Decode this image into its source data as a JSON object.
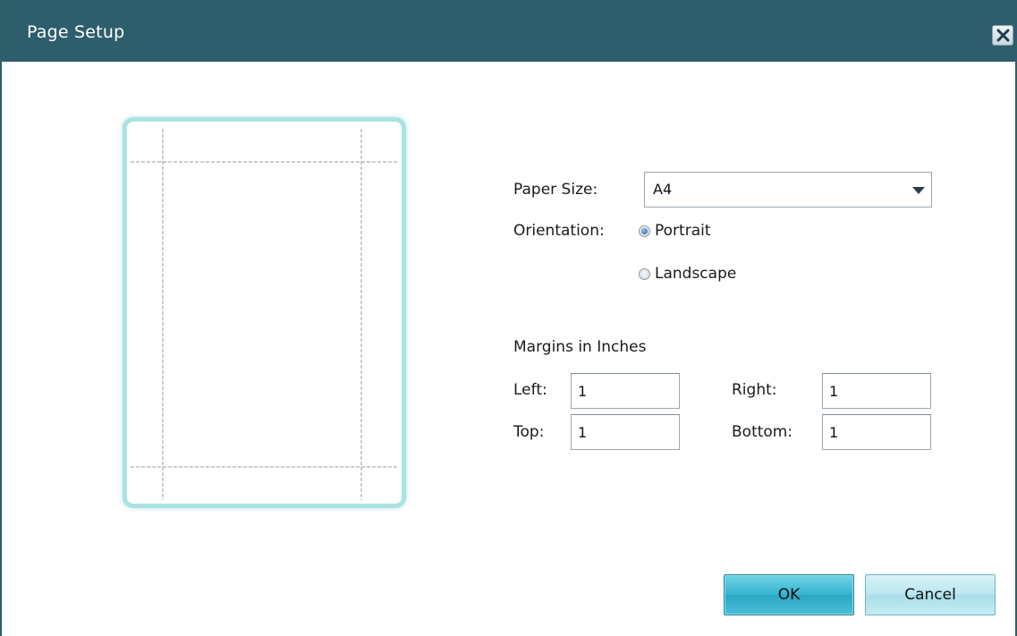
{
  "window": {
    "title": "Page Setup",
    "close_icon": "close-icon"
  },
  "paper": {
    "label": "Paper Size:",
    "value": "A4"
  },
  "orientation": {
    "label": "Orientation:",
    "options": [
      {
        "label": "Portrait",
        "checked": true
      },
      {
        "label": "Landscape",
        "checked": false
      }
    ]
  },
  "margins": {
    "heading": "Margins in Inches",
    "left_label": "Left:",
    "left_value": "1",
    "right_label": "Right:",
    "right_value": "1",
    "top_label": "Top:",
    "top_value": "1",
    "bottom_label": "Bottom:",
    "bottom_value": "1"
  },
  "buttons": {
    "ok": "OK",
    "cancel": "Cancel"
  },
  "colors": {
    "titlebar": "#2e5d6b",
    "preview_border": "#a9e3e3",
    "ok_button": "#36b3cf",
    "cancel_button": "#b8e6ef"
  }
}
